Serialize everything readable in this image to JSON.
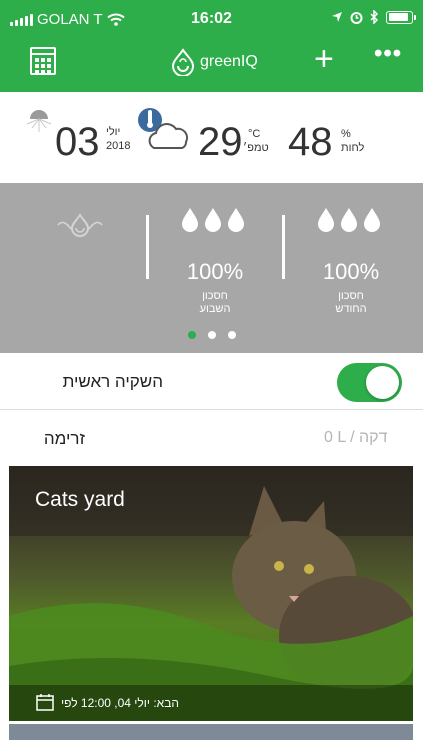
{
  "status_bar": {
    "carrier": "GOLAN T",
    "time": "16:02"
  },
  "nav": {
    "logo_text": "greenIQ",
    "plus_label": "+",
    "more_label": "•••"
  },
  "weather": {
    "day": "03",
    "month": "יולי",
    "year": "2018",
    "temperature": "29",
    "temperature_unit": "°C",
    "temperature_label": "טמפ׳",
    "humidity": "48",
    "humidity_unit": "%",
    "humidity_label": "לחות"
  },
  "savings": {
    "items": [
      {
        "percent": "100%",
        "label_line1": "חסכון",
        "label_line2": "השבוע"
      },
      {
        "percent": "100%",
        "label_line1": "חסכון",
        "label_line2": "החודש"
      }
    ],
    "page_count": 3,
    "active_page": 0
  },
  "main_irrigation": {
    "label": "השקיה ראשית",
    "enabled": true
  },
  "flow": {
    "label": "זרימה",
    "value": "0 L / דקה"
  },
  "zone": {
    "name": "Cats yard",
    "next_run": "הבא: יולי 04, 12:00 לפי"
  },
  "colors": {
    "brand": "#2eae4a",
    "savings_bg": "#a7a7a7"
  }
}
